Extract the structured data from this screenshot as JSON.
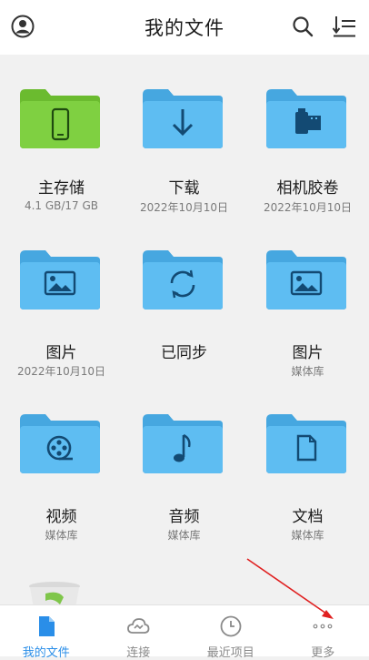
{
  "header": {
    "title": "我的文件"
  },
  "colors": {
    "accent": "#2a8ee8",
    "folder_blue": "#58b9f0",
    "folder_green": "#7acb3c",
    "annotation_arrow": "#e02020"
  },
  "items": [
    {
      "name": "主存储",
      "sub": "4.1 GB/17 GB",
      "icon": "phone-icon",
      "color": "green"
    },
    {
      "name": "下载",
      "sub": "2022年10月10日",
      "icon": "download-icon",
      "color": "blue"
    },
    {
      "name": "相机胶卷",
      "sub": "2022年10月10日",
      "icon": "film-roll-icon",
      "color": "blue"
    },
    {
      "name": "图片",
      "sub": "2022年10月10日",
      "icon": "image-icon",
      "color": "blue"
    },
    {
      "name": "已同步",
      "sub": "",
      "icon": "sync-icon",
      "color": "blue"
    },
    {
      "name": "图片",
      "sub": "媒体库",
      "icon": "image-icon",
      "color": "blue"
    },
    {
      "name": "视频",
      "sub": "媒体库",
      "icon": "video-reel-icon",
      "color": "blue"
    },
    {
      "name": "音频",
      "sub": "媒体库",
      "icon": "music-note-icon",
      "color": "blue"
    },
    {
      "name": "文档",
      "sub": "媒体库",
      "icon": "document-icon",
      "color": "blue"
    }
  ],
  "tabs": [
    {
      "label": "我的文件",
      "icon": "file-icon",
      "active": true
    },
    {
      "label": "连接",
      "icon": "cloud-icon",
      "active": false
    },
    {
      "label": "最近项目",
      "icon": "clock-icon",
      "active": false
    },
    {
      "label": "更多",
      "icon": "more-dots-icon",
      "active": false
    }
  ]
}
